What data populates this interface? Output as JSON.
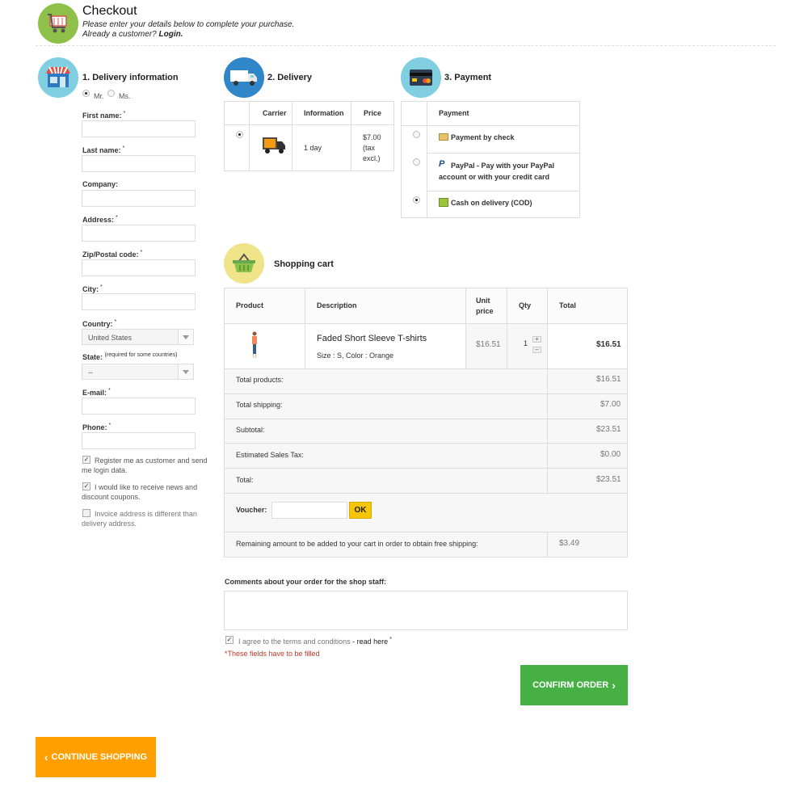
{
  "header": {
    "title": "Checkout",
    "subtitle": "Please enter your details below to complete your purchase.",
    "already_customer": "Already a customer?",
    "login_link": "Login."
  },
  "delivery_info": {
    "title": "1. Delivery information",
    "salutation": {
      "mr": "Mr.",
      "ms": "Ms.",
      "selected": "Mr."
    },
    "fields": {
      "first_name": "First name:",
      "last_name": "Last name:",
      "company": "Company:",
      "address": "Address:",
      "zip": "Zip/Postal code:",
      "city": "City:",
      "country": "Country:",
      "country_value": "United States",
      "state": "State:",
      "state_note": "(required for some countries)",
      "state_value": "--",
      "email": "E-mail:",
      "phone": "Phone:"
    },
    "required_mark": "*",
    "options": {
      "register": "Register me as customer and send me login data.",
      "newsletter": "I would like to receive news and discount coupons.",
      "invoice": "Invoice address is different than delivery address."
    },
    "checked": {
      "register": true,
      "newsletter": true,
      "invoice": false
    }
  },
  "delivery": {
    "title": "2. Delivery",
    "headers": {
      "carrier": "Carrier",
      "information": "Information",
      "price": "Price"
    },
    "row": {
      "information": "1 day",
      "price": "$7.00 (tax excl.)"
    }
  },
  "payment": {
    "title": "3. Payment",
    "header": "Payment",
    "options": [
      {
        "label": "Payment by check",
        "selected": false
      },
      {
        "label": "PayPal - Pay with your PayPal account or with your credit card",
        "selected": false
      },
      {
        "label": "Cash on delivery (COD)",
        "selected": true
      }
    ]
  },
  "cart": {
    "title": "Shopping cart",
    "headers": {
      "product": "Product",
      "description": "Description",
      "unit_price": "Unit price",
      "qty": "Qty",
      "total": "Total"
    },
    "item": {
      "name": "Faded Short Sleeve T-shirts",
      "attributes": "Size : S, Color : Orange",
      "unit_price": "$16.51",
      "qty": "1",
      "total": "$16.51"
    },
    "summary": {
      "total_products_label": "Total products:",
      "total_products": "$16.51",
      "total_shipping_label": "Total shipping:",
      "total_shipping": "$7.00",
      "subtotal_label": "Subtotal:",
      "subtotal": "$23.51",
      "tax_label": "Estimated Sales Tax:",
      "tax": "$0.00",
      "total_label": "Total:",
      "total": "$23.51"
    },
    "voucher_label": "Voucher:",
    "voucher_value": "",
    "ok_button": "OK",
    "free_shipping_label": "Remaining amount to be added to your cart in order to obtain free shipping:",
    "free_shipping_value": "$3.49"
  },
  "comments": {
    "label": "Comments about your order for the shop staff:",
    "value": ""
  },
  "terms": {
    "text": "I agree to the terms and conditions",
    "link": "- read here",
    "checked": true,
    "required_note": "*These fields have to be filled"
  },
  "buttons": {
    "confirm": "CONFIRM ORDER",
    "continue": "CONTINUE SHOPPING"
  },
  "colors": {
    "confirm": "#46b045",
    "continue": "#ff9f00",
    "ok": "#f5c50a",
    "required_note": "#c0392b"
  }
}
